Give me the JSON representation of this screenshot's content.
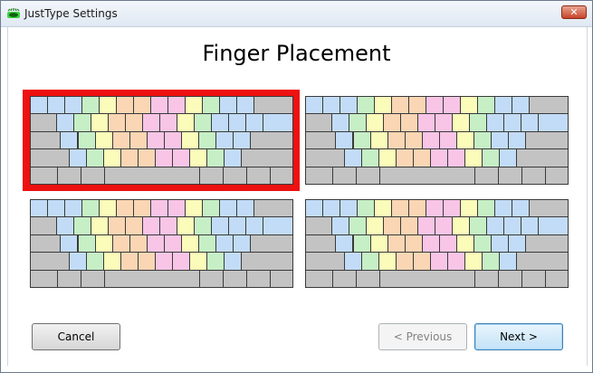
{
  "window": {
    "title": "JustType Settings",
    "close_label": "✕"
  },
  "heading": "Finger Placement",
  "buttons": {
    "cancel": "Cancel",
    "previous": "< Previous",
    "next": "Next >"
  },
  "colors": {
    "pinky": "#c2dcf7",
    "ring": "#c6efc6",
    "middle": "#fbfbba",
    "index_left": "#fad6b4",
    "index_right": "#f9c5e6",
    "modifier": "#c3c3c3",
    "selection": "#ee1111"
  },
  "layouts": [
    {
      "name": "layout-1",
      "selected": true
    },
    {
      "name": "layout-2",
      "selected": false
    },
    {
      "name": "layout-3",
      "selected": false
    },
    {
      "name": "layout-4",
      "selected": false
    }
  ]
}
